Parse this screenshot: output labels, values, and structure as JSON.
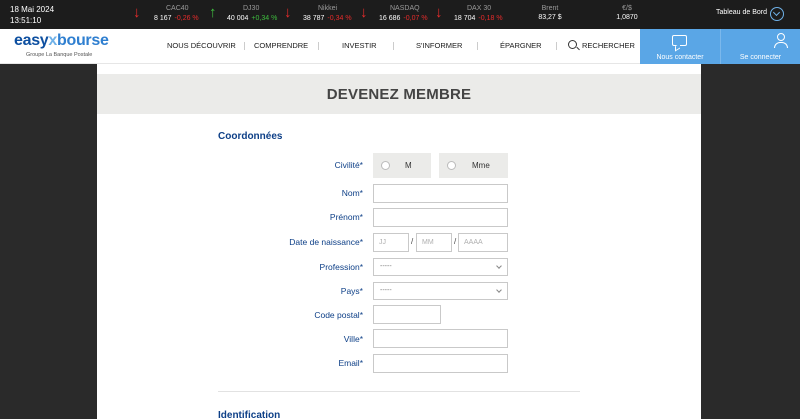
{
  "ticker": {
    "date": "18 Mai 2024",
    "time": "13:51:10",
    "items": [
      {
        "name": "CAC40",
        "value": "8 167",
        "change": "-0,26 %",
        "direction": "down"
      },
      {
        "name": "DJ30",
        "value": "40 004",
        "change": "+0,34 %",
        "direction": "up"
      },
      {
        "name": "Nikkei",
        "value": "38 787",
        "change": "-0,34 %",
        "direction": "down"
      },
      {
        "name": "NASDAQ",
        "value": "16 686",
        "change": "-0,07 %",
        "direction": "down"
      },
      {
        "name": "DAX 30",
        "value": "18 704",
        "change": "-0,18 %",
        "direction": "down"
      }
    ],
    "brent": {
      "name": "Brent",
      "value": "83,27 $"
    },
    "fx": {
      "name": "€/$",
      "value": "1,0870"
    },
    "dashboard_label": "Tableau de Bord",
    "arrow_down_glyph": "↓",
    "arrow_up_glyph": "↑"
  },
  "header": {
    "logo": {
      "part1": "easy",
      "part2": "bourse",
      "subtitle": "Groupe La Banque Postale"
    },
    "nav": [
      "NOUS DÉCOUVRIR",
      "COMPRENDRE",
      "INVESTIR",
      "S'INFORMER",
      "ÉPARGNER"
    ],
    "search_label": "RECHERCHER",
    "contact_label": "Nous contacter",
    "login_label": "Se connecter"
  },
  "page": {
    "title": "DEVENEZ MEMBRE",
    "section1": "Coordonnées",
    "section2": "Identification",
    "form": {
      "civility_label": "Civilité*",
      "civility_options": [
        "M",
        "Mme"
      ],
      "nom_label": "Nom*",
      "prenom_label": "Prénom*",
      "birth_label": "Date de naissance*",
      "birth_day_placeholder": "JJ",
      "birth_month_placeholder": "MM",
      "birth_year_placeholder": "AAAA",
      "date_separator": "/",
      "profession_label": "Profession*",
      "profession_value": "-----",
      "pays_label": "Pays*",
      "pays_value": "-----",
      "postal_label": "Code postal*",
      "ville_label": "Ville*",
      "email_label": "Email*"
    }
  },
  "colors": {
    "accent": "#5aa6e6",
    "navy": "#0d3f87",
    "negative": "#e62b2b",
    "positive": "#3fbf3f"
  }
}
